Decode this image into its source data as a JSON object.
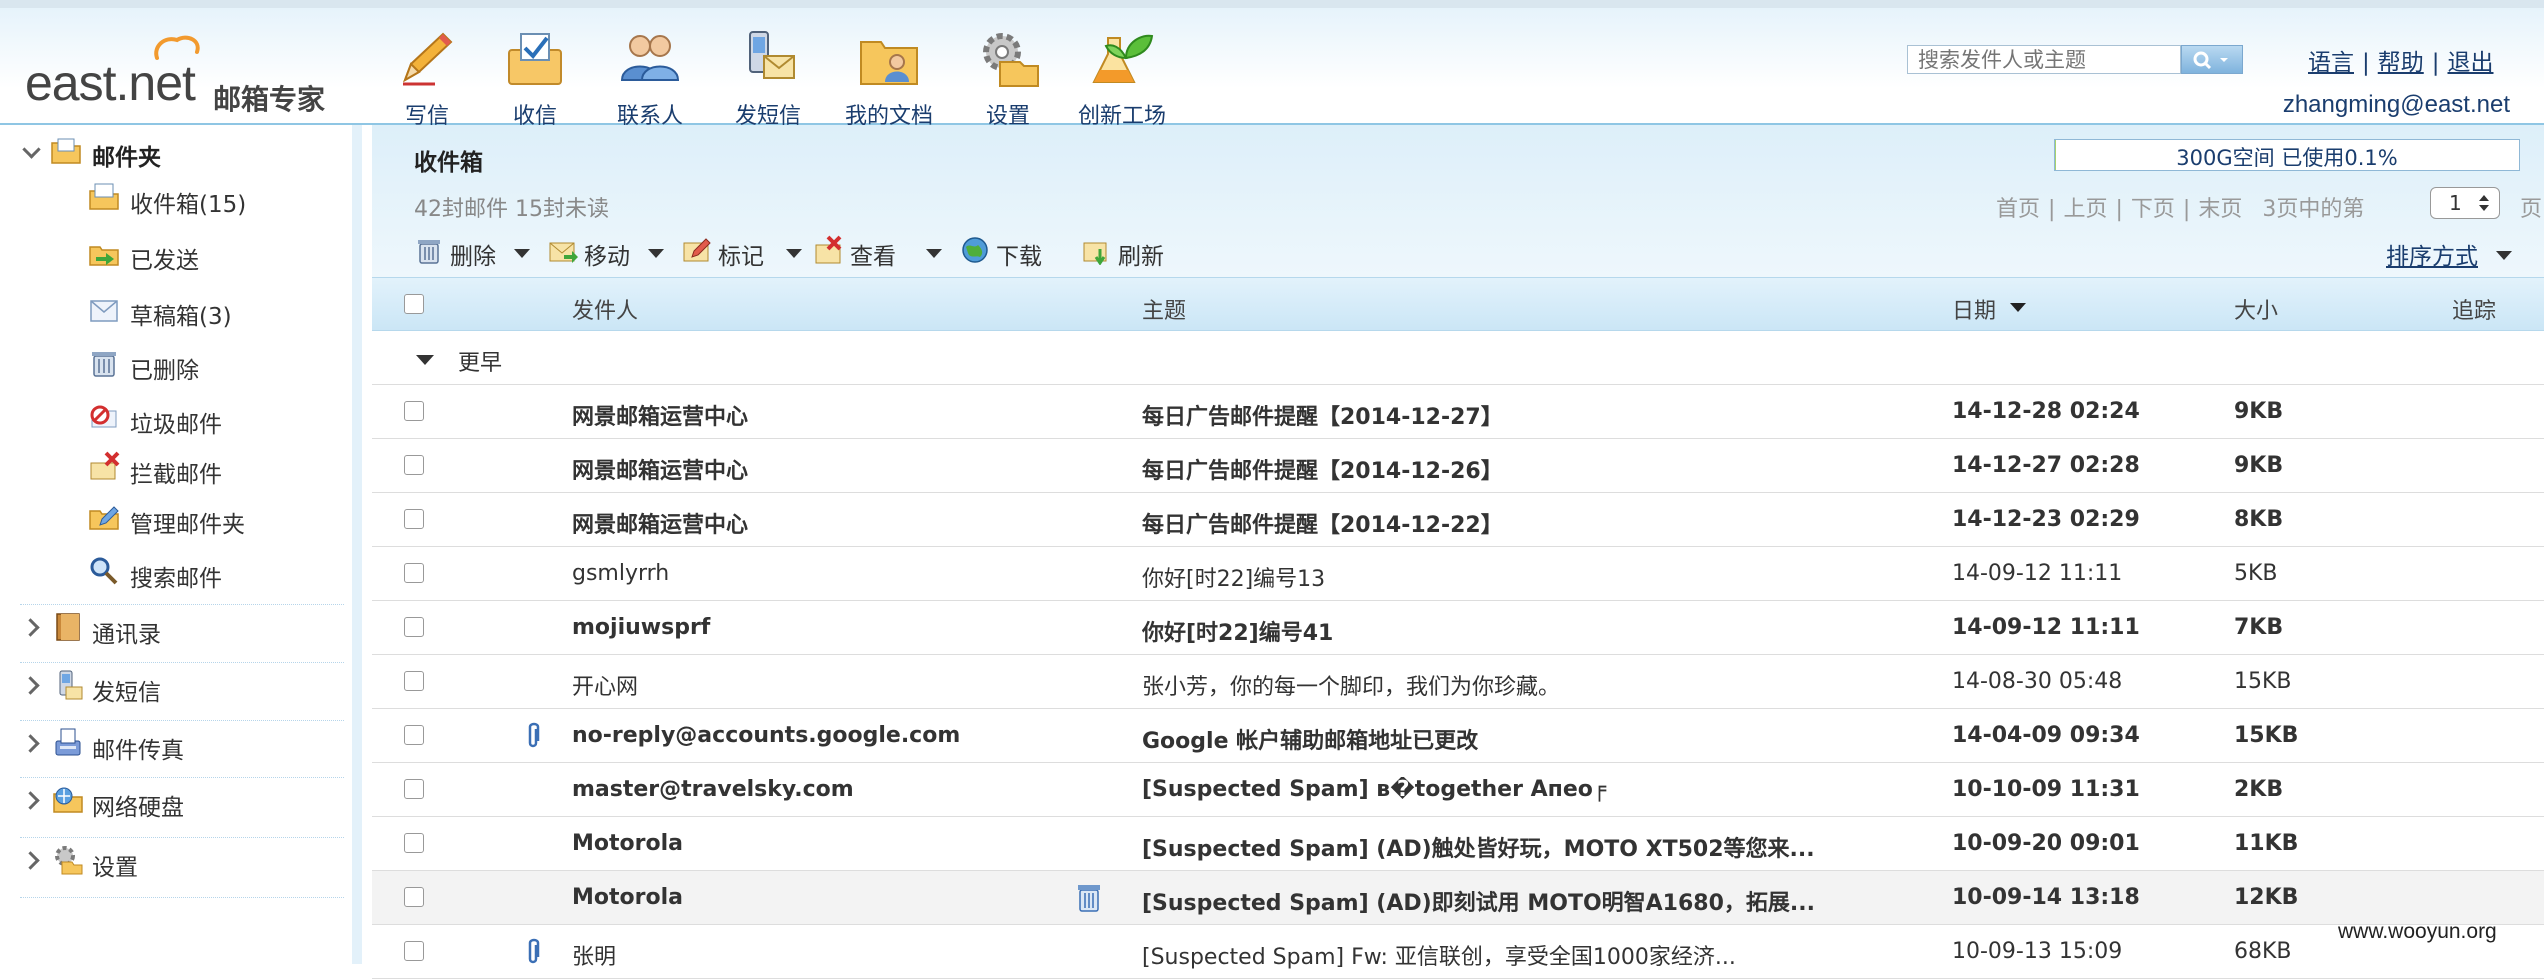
{
  "brand": {
    "name": "east.net",
    "product": "邮箱专家"
  },
  "toolbar": {
    "items": [
      {
        "id": "write",
        "label": "写信"
      },
      {
        "id": "receive",
        "label": "收信"
      },
      {
        "id": "contacts",
        "label": "联系人"
      },
      {
        "id": "sms",
        "label": "发短信"
      },
      {
        "id": "docs",
        "label": "我的文档"
      },
      {
        "id": "settings",
        "label": "设置"
      },
      {
        "id": "lab",
        "label": "创新工场"
      }
    ]
  },
  "search": {
    "placeholder": "搜索发件人或主题"
  },
  "top_links": {
    "language": "语言",
    "help": "帮助",
    "logout": "退出",
    "separator": "|"
  },
  "user": {
    "email": "zhangming@east.net"
  },
  "sidebar": {
    "mailbox_title": "邮件夹",
    "folders": [
      {
        "label": "收件箱(15)",
        "icon": "inbox-folder-icon"
      },
      {
        "label": "已发送",
        "icon": "sent-folder-icon"
      },
      {
        "label": "草稿箱(3)",
        "icon": "drafts-folder-icon"
      },
      {
        "label": "已删除",
        "icon": "trash-folder-icon"
      },
      {
        "label": "垃圾邮件",
        "icon": "spam-folder-icon"
      },
      {
        "label": "拦截邮件",
        "icon": "blocked-folder-icon"
      },
      {
        "label": "管理邮件夹",
        "icon": "manage-folder-icon"
      },
      {
        "label": "搜索邮件",
        "icon": "search-mail-icon"
      }
    ],
    "groups": [
      {
        "label": "通讯录",
        "icon": "address-book-icon"
      },
      {
        "label": "发短信",
        "icon": "sms-icon"
      },
      {
        "label": "邮件传真",
        "icon": "fax-icon"
      },
      {
        "label": "网络硬盘",
        "icon": "network-disk-icon"
      },
      {
        "label": "设置",
        "icon": "settings-icon"
      }
    ]
  },
  "inbox": {
    "title": "收件箱",
    "quota_text": "300G空间 已使用0.1%",
    "quota_used_fraction": 0.001,
    "count_text": "42封邮件 15封未读",
    "pager": {
      "first": "首页",
      "prev": "上页",
      "next": "下页",
      "last": "末页",
      "info": "3页中的第",
      "current": "1",
      "suffix": "页",
      "separator": "|"
    },
    "actions": {
      "delete": "删除",
      "move": "移动",
      "mark": "标记",
      "view": "查看",
      "download": "下载",
      "refresh": "刷新"
    },
    "sort_label": "排序方式",
    "columns": {
      "sender": "发件人",
      "subject": "主题",
      "date": "日期",
      "size": "大小",
      "track": "追踪"
    },
    "group_label": "更早",
    "rows": [
      {
        "sender": "网景邮箱运营中心",
        "subject": "每日广告邮件提醒【2014-12-27】",
        "date": "14-12-28 02:24",
        "size": "9KB",
        "unread": true,
        "attachment": false
      },
      {
        "sender": "网景邮箱运营中心",
        "subject": "每日广告邮件提醒【2014-12-26】",
        "date": "14-12-27 02:28",
        "size": "9KB",
        "unread": true,
        "attachment": false
      },
      {
        "sender": "网景邮箱运营中心",
        "subject": "每日广告邮件提醒【2014-12-22】",
        "date": "14-12-23 02:29",
        "size": "8KB",
        "unread": true,
        "attachment": false
      },
      {
        "sender": "gsmlyrrh",
        "subject": "你好[时22]编号13",
        "date": "14-09-12 11:11",
        "size": "5KB",
        "unread": false,
        "attachment": false
      },
      {
        "sender": "mojiuwsprf",
        "subject": "你好[时22]编号41",
        "date": "14-09-12 11:11",
        "size": "7KB",
        "unread": true,
        "attachment": false
      },
      {
        "sender": "开心网",
        "subject": "张小芳，你的每一个脚印，我们为你珍藏。",
        "date": "14-08-30 05:48",
        "size": "15KB",
        "unread": false,
        "attachment": false
      },
      {
        "sender": "no-reply@accounts.google.com",
        "subject": "Google 帐户辅助邮箱地址已更改",
        "date": "14-04-09 09:34",
        "size": "15KB",
        "unread": true,
        "attachment": true
      },
      {
        "sender": "master@travelsky.com",
        "subject": "[Suspected Spam] в�together Апео╒",
        "date": "10-10-09 11:31",
        "size": "2KB",
        "unread": true,
        "attachment": false
      },
      {
        "sender": "Motorola",
        "subject": "[Suspected Spam] (AD)触处皆好玩，MOTO XT502等您来...",
        "date": "10-09-20 09:01",
        "size": "11KB",
        "unread": true,
        "attachment": false
      },
      {
        "sender": "Motorola",
        "subject": "[Suspected Spam] (AD)即刻试用 MOTO明智A1680，拓展...",
        "date": "10-09-14 13:18",
        "size": "12KB",
        "unread": true,
        "attachment": false,
        "hover": true
      },
      {
        "sender": "张明",
        "subject": "[Suspected Spam] Fw: 亚信联创，享受全国1000家经济...",
        "date": "10-09-13 15:09",
        "size": "68KB",
        "unread": false,
        "attachment": true
      }
    ]
  },
  "watermark": "www.wooyun.org"
}
